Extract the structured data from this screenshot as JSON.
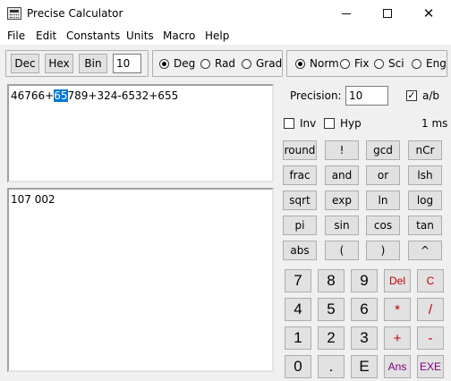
{
  "window": {
    "title": "Precise Calculator"
  },
  "menu": [
    "File",
    "Edit",
    "Constants",
    "Units",
    "Macro",
    "Help"
  ],
  "toolbar": {
    "base_buttons": [
      "Dec",
      "Hex",
      "Bin"
    ],
    "digits_value": "10",
    "angle_modes": [
      {
        "label": "Deg",
        "selected": true
      },
      {
        "label": "Rad",
        "selected": false
      },
      {
        "label": "Grad",
        "selected": false
      }
    ],
    "format_modes": [
      {
        "label": "Norm",
        "selected": true
      },
      {
        "label": "Fix",
        "selected": false
      },
      {
        "label": "Sci",
        "selected": false
      },
      {
        "label": "Eng",
        "selected": false
      }
    ]
  },
  "expression": {
    "before": "46766+",
    "selected": "65",
    "after": "789+324-6532+655"
  },
  "result": "107 002",
  "precision": {
    "label": "Precision:",
    "value": "10"
  },
  "ab_check": {
    "label": "a/b",
    "checked": true
  },
  "inv_check": {
    "label": "Inv",
    "checked": false
  },
  "hyp_check": {
    "label": "Hyp",
    "checked": false
  },
  "timing": "1 ms",
  "functions": [
    [
      "round",
      "!",
      "gcd",
      "nCr"
    ],
    [
      "frac",
      "and",
      "or",
      "lsh"
    ],
    [
      "sqrt",
      "exp",
      "ln",
      "log"
    ],
    [
      "pi",
      "sin",
      "cos",
      "tan"
    ],
    [
      "abs",
      "(",
      ")",
      "^"
    ]
  ],
  "keypad": [
    [
      "7",
      "8",
      "9",
      "Del",
      "C"
    ],
    [
      "4",
      "5",
      "6",
      "*",
      "/"
    ],
    [
      "1",
      "2",
      "3",
      "+",
      "-"
    ],
    [
      "0",
      ".",
      "E",
      "Ans",
      "EXE"
    ]
  ],
  "colors": {
    "selection": "#0078d7",
    "red_keys": "#c00000",
    "purple_keys": "#800080"
  }
}
